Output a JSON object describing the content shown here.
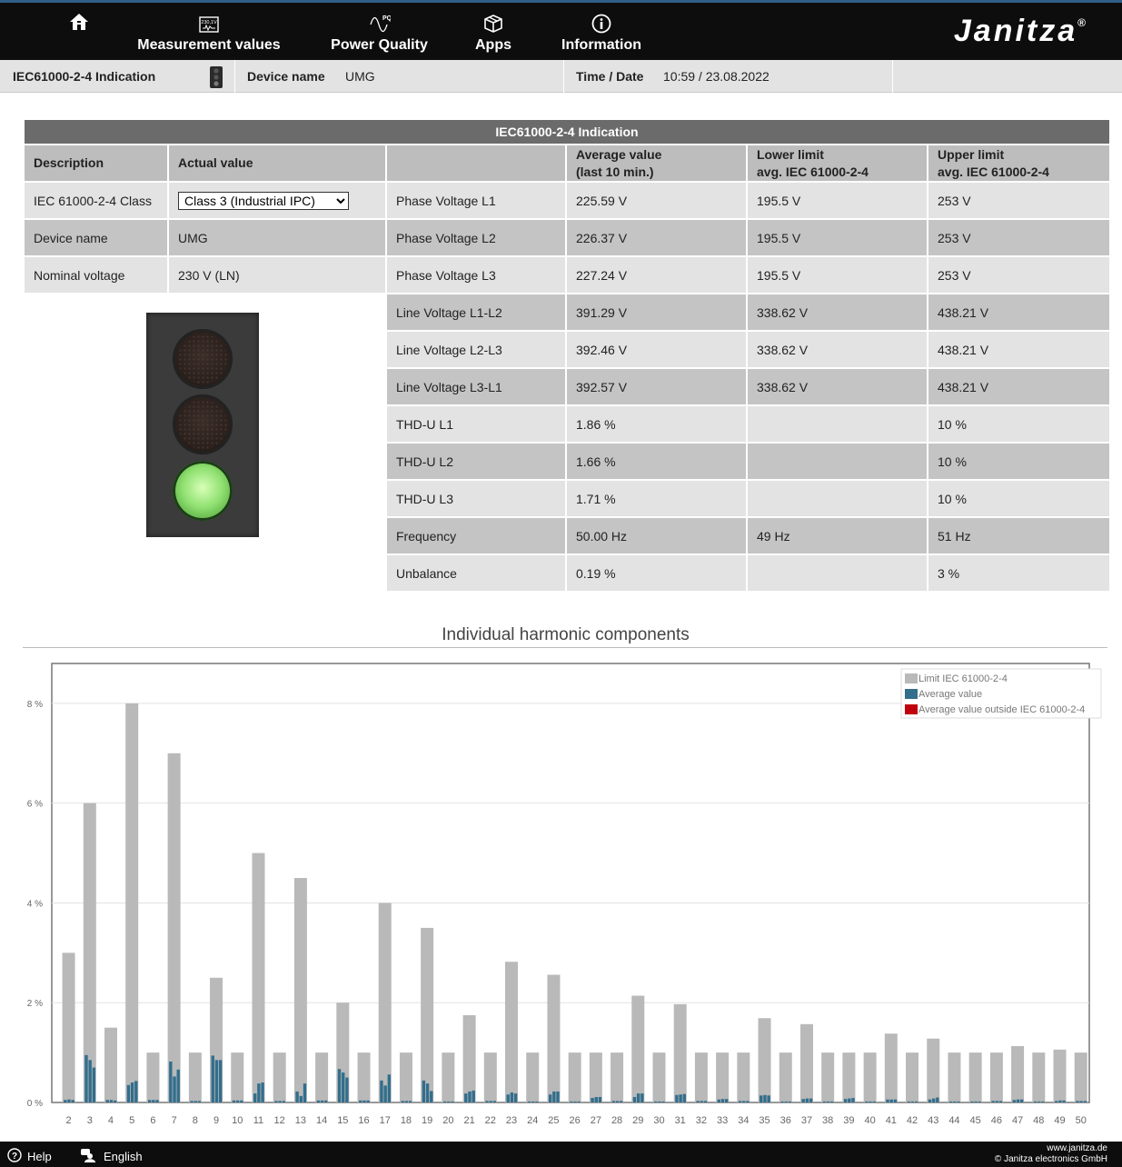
{
  "nav": {
    "home_icon": "home-icon",
    "items": [
      {
        "label": "Measurement values",
        "icon": "meter-display-icon",
        "icon_text": "230,1V"
      },
      {
        "label": "Power Quality",
        "icon": "pq-waveform-icon",
        "icon_text": "PQ"
      },
      {
        "label": "Apps",
        "icon": "box-icon"
      },
      {
        "label": "Information",
        "icon": "info-icon"
      }
    ],
    "brand": "Janitza",
    "brand_mark": "®"
  },
  "status": {
    "page_name": "IEC61000-2-4 Indication",
    "device_label": "Device name",
    "device_value": "UMG",
    "time_label": "Time / Date",
    "time_value": "10:59 / 23.08.2022"
  },
  "table": {
    "title": "IEC61000-2-4 Indication",
    "headers": {
      "description": "Description",
      "actual": "Actual value",
      "avg1": "Average value",
      "avg2": "(last 10 min.)",
      "lower1": "Lower limit",
      "lower2": "avg. IEC 61000-2-4",
      "upper1": "Upper limit",
      "upper2": "avg. IEC 61000-2-4"
    },
    "settings": [
      {
        "description": "IEC 61000-2-4 Class",
        "value": "Class 3 (Industrial IPC)"
      },
      {
        "description": "Device name",
        "value": "UMG"
      },
      {
        "description": "Nominal voltage",
        "value": "230 V (LN)"
      }
    ],
    "class_options": [
      "Class 3 (Industrial IPC)"
    ],
    "rows": [
      {
        "name": "Phase Voltage L1",
        "avg": "225.59 V",
        "lower": "195.5 V",
        "upper": "253 V"
      },
      {
        "name": "Phase Voltage L2",
        "avg": "226.37 V",
        "lower": "195.5 V",
        "upper": "253 V"
      },
      {
        "name": "Phase Voltage L3",
        "avg": "227.24 V",
        "lower": "195.5 V",
        "upper": "253 V"
      },
      {
        "name": "Line Voltage L1-L2",
        "avg": "391.29 V",
        "lower": "338.62 V",
        "upper": "438.21 V"
      },
      {
        "name": "Line Voltage L2-L3",
        "avg": "392.46 V",
        "lower": "338.62 V",
        "upper": "438.21 V"
      },
      {
        "name": "Line Voltage L3-L1",
        "avg": "392.57 V",
        "lower": "338.62 V",
        "upper": "438.21 V"
      },
      {
        "name": "THD-U L1",
        "avg": "1.86 %",
        "lower": "",
        "upper": "10 %"
      },
      {
        "name": "THD-U L2",
        "avg": "1.66 %",
        "lower": "",
        "upper": "10 %"
      },
      {
        "name": "THD-U L3",
        "avg": "1.71 %",
        "lower": "",
        "upper": "10 %"
      },
      {
        "name": "Frequency",
        "avg": "50.00 Hz",
        "lower": "49 Hz",
        "upper": "51 Hz"
      },
      {
        "name": "Unbalance",
        "avg": "0.19 %",
        "lower": "",
        "upper": "3 %"
      }
    ]
  },
  "indicator": {
    "state": "green"
  },
  "chart_data": {
    "type": "bar",
    "title": "Individual harmonic components",
    "ylim": [
      0,
      8.8
    ],
    "yticks": [
      "0 %",
      "2 %",
      "4 %",
      "6 %",
      "8 %"
    ],
    "ytick_values": [
      0,
      2,
      4,
      6,
      8
    ],
    "categories": [
      "2",
      "3",
      "4",
      "5",
      "6",
      "7",
      "8",
      "9",
      "10",
      "11",
      "12",
      "13",
      "14",
      "15",
      "16",
      "17",
      "18",
      "19",
      "20",
      "21",
      "22",
      "23",
      "24",
      "25",
      "26",
      "27",
      "28",
      "29",
      "30",
      "31",
      "32",
      "33",
      "34",
      "35",
      "36",
      "37",
      "38",
      "39",
      "40",
      "41",
      "42",
      "43",
      "44",
      "45",
      "46",
      "47",
      "48",
      "49",
      "50"
    ],
    "legend": {
      "position": "top-right",
      "entries": [
        "Limit IEC 61000-2-4",
        "Average value",
        "Average value outside IEC 61000-2-4"
      ]
    },
    "colors": {
      "limit": "#b9b9b9",
      "average": "#336e8c",
      "outside": "#c0000b"
    },
    "series": [
      {
        "name": "Limit IEC 61000-2-4",
        "values": [
          3,
          6,
          1.5,
          8,
          1,
          7,
          1,
          2.5,
          1,
          5,
          1,
          4.5,
          1,
          2,
          1,
          4,
          1,
          3.5,
          1,
          1.75,
          1,
          2.82,
          1,
          2.56,
          1,
          1,
          1,
          2.14,
          1,
          1.97,
          1,
          1,
          1,
          1.69,
          1,
          1.57,
          1,
          1,
          1,
          1.38,
          1,
          1.28,
          1,
          1,
          1,
          1.13,
          1,
          1.06,
          1
        ]
      },
      {
        "name": "Average value",
        "values": [
          [
            0.05,
            0.06,
            0.05
          ],
          [
            0.95,
            0.85,
            0.7
          ],
          [
            0.05,
            0.05,
            0.04
          ],
          [
            0.35,
            0.4,
            0.43
          ],
          [
            0.05,
            0.05,
            0.05
          ],
          [
            0.82,
            0.52,
            0.66
          ],
          [
            0.03,
            0.03,
            0.03
          ],
          [
            0.94,
            0.85,
            0.85
          ],
          [
            0.04,
            0.04,
            0.04
          ],
          [
            0.18,
            0.38,
            0.4
          ],
          [
            0.03,
            0.03,
            0.03
          ],
          [
            0.22,
            0.13,
            0.38
          ],
          [
            0.04,
            0.04,
            0.04
          ],
          [
            0.67,
            0.6,
            0.5
          ],
          [
            0.04,
            0.04,
            0.04
          ],
          [
            0.44,
            0.34,
            0.56
          ],
          [
            0.03,
            0.03,
            0.03
          ],
          [
            0.44,
            0.38,
            0.23
          ],
          [
            0.02,
            0.02,
            0.02
          ],
          [
            0.18,
            0.22,
            0.24
          ],
          [
            0.03,
            0.03,
            0.03
          ],
          [
            0.16,
            0.2,
            0.18
          ],
          [
            0.02,
            0.02,
            0.02
          ],
          [
            0.16,
            0.22,
            0.22
          ],
          [
            0.02,
            0.02,
            0.02
          ],
          [
            0.09,
            0.11,
            0.11
          ],
          [
            0.03,
            0.03,
            0.03
          ],
          [
            0.11,
            0.18,
            0.18
          ],
          [
            0.02,
            0.02,
            0.02
          ],
          [
            0.15,
            0.16,
            0.17
          ],
          [
            0.03,
            0.03,
            0.03
          ],
          [
            0.06,
            0.07,
            0.07
          ],
          [
            0.03,
            0.03,
            0.03
          ],
          [
            0.14,
            0.15,
            0.14
          ],
          [
            0.02,
            0.02,
            0.02
          ],
          [
            0.07,
            0.08,
            0.08
          ],
          [
            0.02,
            0.02,
            0.02
          ],
          [
            0.07,
            0.08,
            0.09
          ],
          [
            0.02,
            0.02,
            0.02
          ],
          [
            0.06,
            0.06,
            0.06
          ],
          [
            0.02,
            0.02,
            0.02
          ],
          [
            0.06,
            0.08,
            0.1
          ],
          [
            0.02,
            0.02,
            0.02
          ],
          [
            0.02,
            0.02,
            0.02
          ],
          [
            0.03,
            0.03,
            0.03
          ],
          [
            0.05,
            0.06,
            0.06
          ],
          [
            0.02,
            0.02,
            0.02
          ],
          [
            0.03,
            0.04,
            0.04
          ],
          [
            0.03,
            0.03,
            0.03
          ]
        ]
      }
    ]
  },
  "footer": {
    "help": "Help",
    "language": "English",
    "website": "www.janitza.de",
    "copyright": "© Janitza electronics GmbH"
  }
}
